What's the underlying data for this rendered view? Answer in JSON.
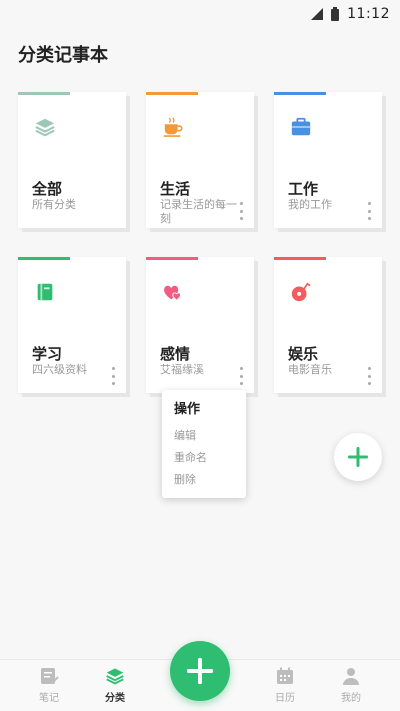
{
  "status_bar": {
    "time": "11:12"
  },
  "app": {
    "title": "分类记事本"
  },
  "categories": [
    {
      "title": "全部",
      "subtitle": "所有分类",
      "accent": "#9fc7b7",
      "icon": "layers-icon"
    },
    {
      "title": "生活",
      "subtitle": "记录生活的每一刻",
      "accent": "#f29a3b",
      "icon": "coffee-cup-icon"
    },
    {
      "title": "工作",
      "subtitle": "我的工作",
      "accent": "#4a90e2",
      "icon": "briefcase-icon"
    },
    {
      "title": "学习",
      "subtitle": "四六级资料",
      "accent": "#2ebd71",
      "icon": "book-icon"
    },
    {
      "title": "感情",
      "subtitle": "艾福缘溪",
      "accent": "#f25c82",
      "icon": "hearts-icon"
    },
    {
      "title": "娱乐",
      "subtitle": "电影音乐",
      "accent": "#f25c5c",
      "icon": "music-disc-icon"
    }
  ],
  "context_menu": {
    "title": "操作",
    "items": [
      "编辑",
      "重命名",
      "删除"
    ]
  },
  "bottom_nav": {
    "items": [
      {
        "label": "笔记",
        "icon": "note-icon",
        "active": false
      },
      {
        "label": "分类",
        "icon": "layers-icon",
        "active": true
      },
      {
        "label": "日历",
        "icon": "calendar-icon",
        "active": false
      },
      {
        "label": "我的",
        "icon": "person-icon",
        "active": false
      }
    ]
  },
  "colors": {
    "primary": "#2ebd71",
    "background": "#f7f7f7",
    "text": "#222222",
    "muted": "#999999"
  }
}
